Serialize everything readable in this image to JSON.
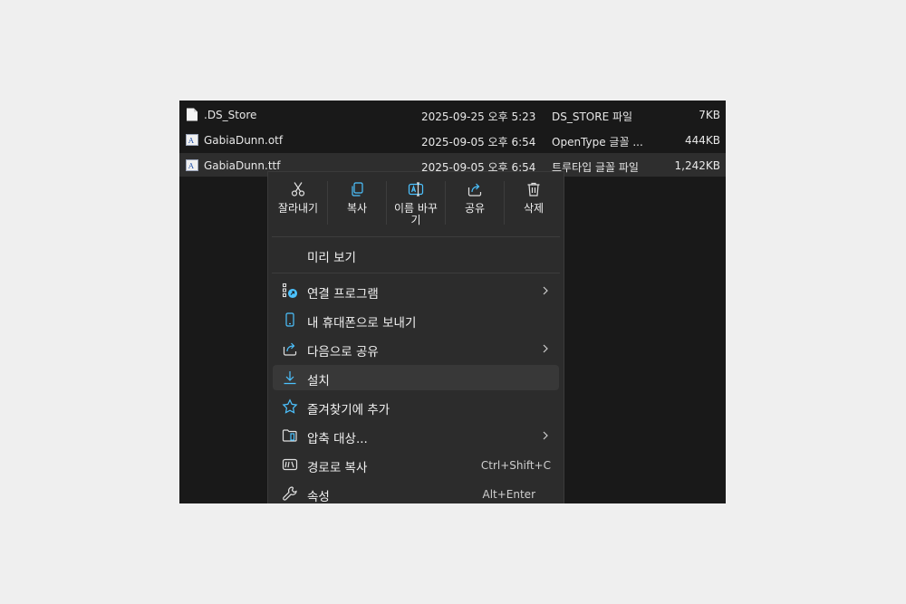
{
  "files": [
    {
      "name": ".DS_Store",
      "date": "2025-09-25 오후 5:23",
      "type": "DS_STORE 파일",
      "size": "7KB",
      "icon": "blank-file-icon"
    },
    {
      "name": "GabiaDunn.otf",
      "date": "2025-09-05 오후 6:54",
      "type": "OpenType 글꼴 ...",
      "size": "444KB",
      "icon": "font-file-icon"
    },
    {
      "name": "GabiaDunn.ttf",
      "date": "2025-09-05 오후 6:54",
      "type": "트루타입 글꼴 파일",
      "size": "1,242KB",
      "icon": "font-file-icon",
      "selected": true
    }
  ],
  "context_menu": {
    "quick_actions": [
      {
        "label": "잘라내기",
        "icon": "scissors-icon"
      },
      {
        "label": "복사",
        "icon": "copy-icon"
      },
      {
        "label": "이름 바꾸기",
        "icon": "rename-icon"
      },
      {
        "label": "공유",
        "icon": "share-icon"
      },
      {
        "label": "삭제",
        "icon": "trash-icon"
      }
    ],
    "preview_label": "미리 보기",
    "items": [
      {
        "label": "연결 프로그램",
        "icon": "open-with-icon",
        "submenu": true
      },
      {
        "label": "내 휴대폰으로 보내기",
        "icon": "phone-icon"
      },
      {
        "label": "다음으로 공유",
        "icon": "share-icon",
        "submenu": true
      },
      {
        "label": "설치",
        "icon": "install-download-icon",
        "hovered": true
      },
      {
        "label": "즐겨찾기에 추가",
        "icon": "star-icon"
      },
      {
        "label": "압축 대상...",
        "icon": "zip-folder-icon",
        "submenu": true
      },
      {
        "label": "경로로 복사",
        "icon": "copy-path-icon",
        "shortcut": "Ctrl+Shift+C"
      },
      {
        "label": "속성",
        "icon": "wrench-icon",
        "shortcut": "Alt+Enter"
      }
    ]
  },
  "colors": {
    "accent": "#4cc2ff",
    "explorer_bg": "#191919",
    "menu_bg": "#2c2c2c",
    "page_bg": "#efefef"
  }
}
